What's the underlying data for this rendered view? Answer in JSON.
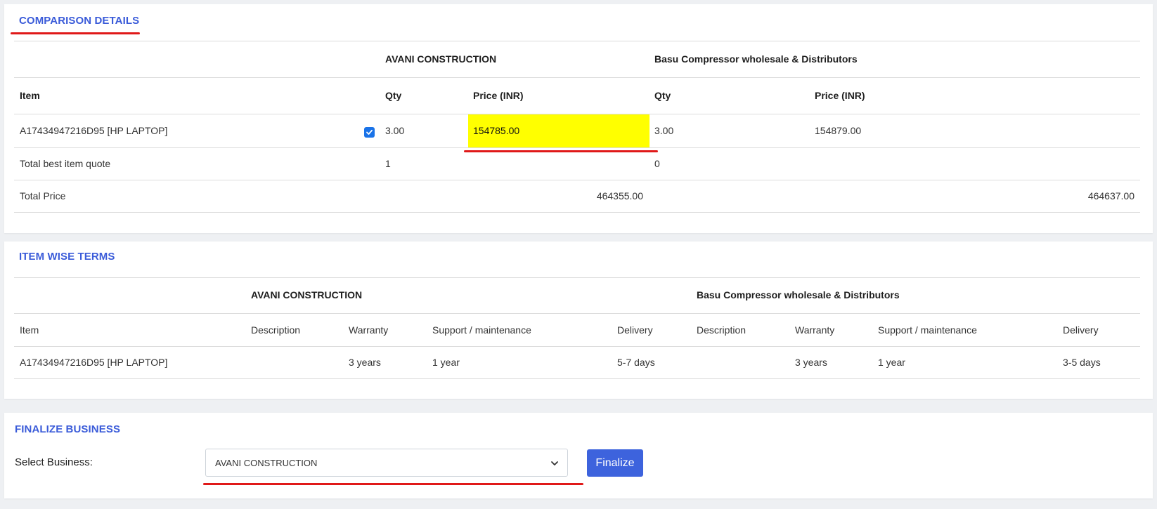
{
  "comparison": {
    "title": "COMPARISON DETAILS",
    "vendor1": "AVANI CONSTRUCTION",
    "vendor2": "Basu Compressor wholesale & Distributors",
    "headers": {
      "item": "Item",
      "qty1": "Qty",
      "price1": "Price (INR)",
      "qty2": "Qty",
      "price2": "Price (INR)"
    },
    "rows": [
      {
        "item": "A17434947216D95 [HP LAPTOP]",
        "checked": true,
        "qty1": "3.00",
        "price1": "154785.00",
        "qty2": "3.00",
        "price2": "154879.00"
      }
    ],
    "best_quote": {
      "label": "Total best item quote",
      "v1": "1",
      "v2": "0"
    },
    "total_price": {
      "label": "Total Price",
      "v1": "464355.00",
      "v2": "464637.00"
    }
  },
  "terms": {
    "title": "ITEM WISE TERMS",
    "vendor1": "AVANI CONSTRUCTION",
    "vendor2": "Basu Compressor wholesale & Distributors",
    "headers": {
      "item": "Item",
      "desc1": "Description",
      "warranty1": "Warranty",
      "support1": "Support / maintenance",
      "delivery1": "Delivery",
      "desc2": "Description",
      "warranty2": "Warranty",
      "support2": "Support / maintenance",
      "delivery2": "Delivery"
    },
    "rows": [
      {
        "item": "A17434947216D95 [HP LAPTOP]",
        "desc1": "",
        "warranty1": "3 years",
        "support1": "1 year",
        "delivery1": "5-7 days",
        "desc2": "",
        "warranty2": "3 years",
        "support2": "1 year",
        "delivery2": "3-5 days"
      }
    ]
  },
  "finalize": {
    "title": "FINALIZE BUSINESS",
    "select_label": "Select Business:",
    "selected": "AVANI CONSTRUCTION",
    "button": "Finalize"
  },
  "colors": {
    "accent": "#3a5bd9",
    "annotation": "#e01919",
    "highlight": "#ffff00",
    "button": "#3d63dd"
  }
}
